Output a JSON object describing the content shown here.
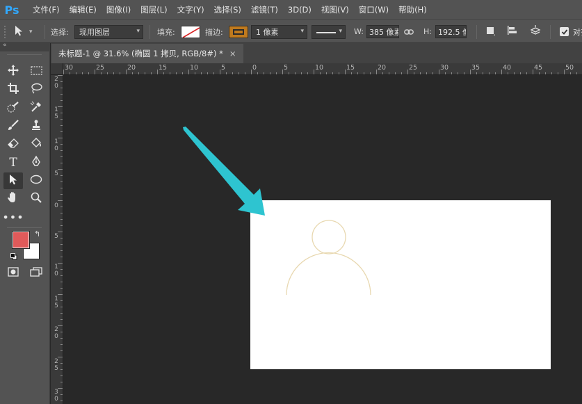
{
  "app": {
    "logo": "Ps"
  },
  "menu": [
    "文件(F)",
    "编辑(E)",
    "图像(I)",
    "图层(L)",
    "文字(Y)",
    "选择(S)",
    "滤镜(T)",
    "3D(D)",
    "视图(V)",
    "窗口(W)",
    "帮助(H)"
  ],
  "options": {
    "select_label": "选择:",
    "select_value": "现用图层",
    "fill_label": "填充:",
    "stroke_label": "描边:",
    "stroke_width": "1 像素",
    "w_label": "W:",
    "w_value": "385 像素",
    "h_label": "H:",
    "h_value": "192.5 像",
    "align_label": "对齐"
  },
  "document": {
    "tab_title": "未标题-1 @ 31.6% (椭圆 1 拷贝, RGB/8#) *",
    "close": "×"
  },
  "ruler_top": [
    "30",
    "25",
    "20",
    "15",
    "10",
    "5",
    "0",
    "5",
    "10",
    "15",
    "20",
    "25",
    "30",
    "35",
    "40",
    "45",
    "50"
  ],
  "ruler_left": [
    "2",
    "0",
    "1",
    "5",
    "1",
    "0",
    "5",
    "0",
    "5",
    "1",
    "0",
    "1",
    "5",
    "2",
    "0",
    "2",
    "5",
    "3",
    "0"
  ],
  "colors": {
    "foreground": "#e05a5a",
    "background": "#ffffff",
    "stroke_swatch": "#c07a1e",
    "arrow": "#2ec4d0",
    "figure_stroke": "#e8d8b0"
  }
}
